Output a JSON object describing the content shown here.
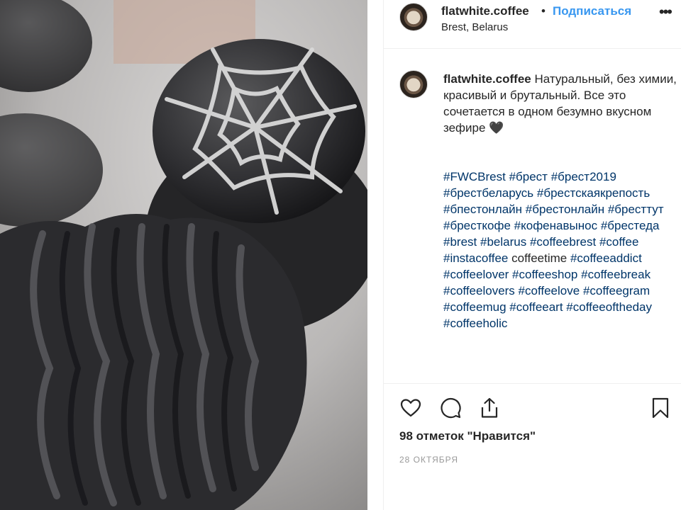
{
  "post": {
    "photo": {
      "subject": "black charcoal marshmallows with white icing spider-web"
    },
    "header": {
      "username": "flatwhite.coffee",
      "separator": "•",
      "follow_label": "Подписаться",
      "location": "Brest, Belarus",
      "more_icon": "more-horizontal-icon"
    },
    "caption": {
      "username": "flatwhite.coffee",
      "text": "Натуральный, без химии, красивый и брутальный. Все это сочетается в одном безумно вкусном зефире 🖤",
      "hashtags": [
        {
          "text": "#FWCBrest",
          "link": true
        },
        {
          "text": "#брест",
          "link": true
        },
        {
          "text": "#брест2019",
          "link": true
        },
        {
          "text": "#брестбеларусь",
          "link": true
        },
        {
          "text": "#брестскаякрепость",
          "link": true
        },
        {
          "text": "#бпестонлайн",
          "link": true
        },
        {
          "text": "#брестонлайн",
          "link": true
        },
        {
          "text": "#бресттут",
          "link": true
        },
        {
          "text": "#бресткофе",
          "link": true
        },
        {
          "text": "#кофенавынос",
          "link": true
        },
        {
          "text": "#брестеда",
          "link": true
        },
        {
          "text": "#brest",
          "link": true
        },
        {
          "text": "#belarus",
          "link": true
        },
        {
          "text": "#coffeebrest",
          "link": true
        },
        {
          "text": "#coffee",
          "link": true
        },
        {
          "text": "#instacoffee",
          "link": true
        },
        {
          "text": "coffeetime",
          "link": false
        },
        {
          "text": "#coffeeaddict",
          "link": true
        },
        {
          "text": "#coffeelover",
          "link": true
        },
        {
          "text": "#coffeeshop",
          "link": true
        },
        {
          "text": "#coffeebreak",
          "link": true
        },
        {
          "text": "#coffeelovers",
          "link": true
        },
        {
          "text": "#coffeelove",
          "link": true
        },
        {
          "text": "#coffeegram",
          "link": true
        },
        {
          "text": "#coffeemug",
          "link": true
        },
        {
          "text": "#coffeeart",
          "link": true
        },
        {
          "text": "#coffeeoftheday",
          "link": true
        },
        {
          "text": "#coffeeholic",
          "link": true
        }
      ]
    },
    "actions": {
      "like_icon": "heart-icon",
      "comment_icon": "comment-icon",
      "share_icon": "share-icon",
      "save_icon": "bookmark-icon"
    },
    "likes": "98 отметок \"Нравится\"",
    "date": "28 ОКТЯБРЯ"
  },
  "colors": {
    "link": "#003569",
    "follow": "#3897f0",
    "text": "#262626",
    "muted": "#999999",
    "border": "#efefef"
  }
}
